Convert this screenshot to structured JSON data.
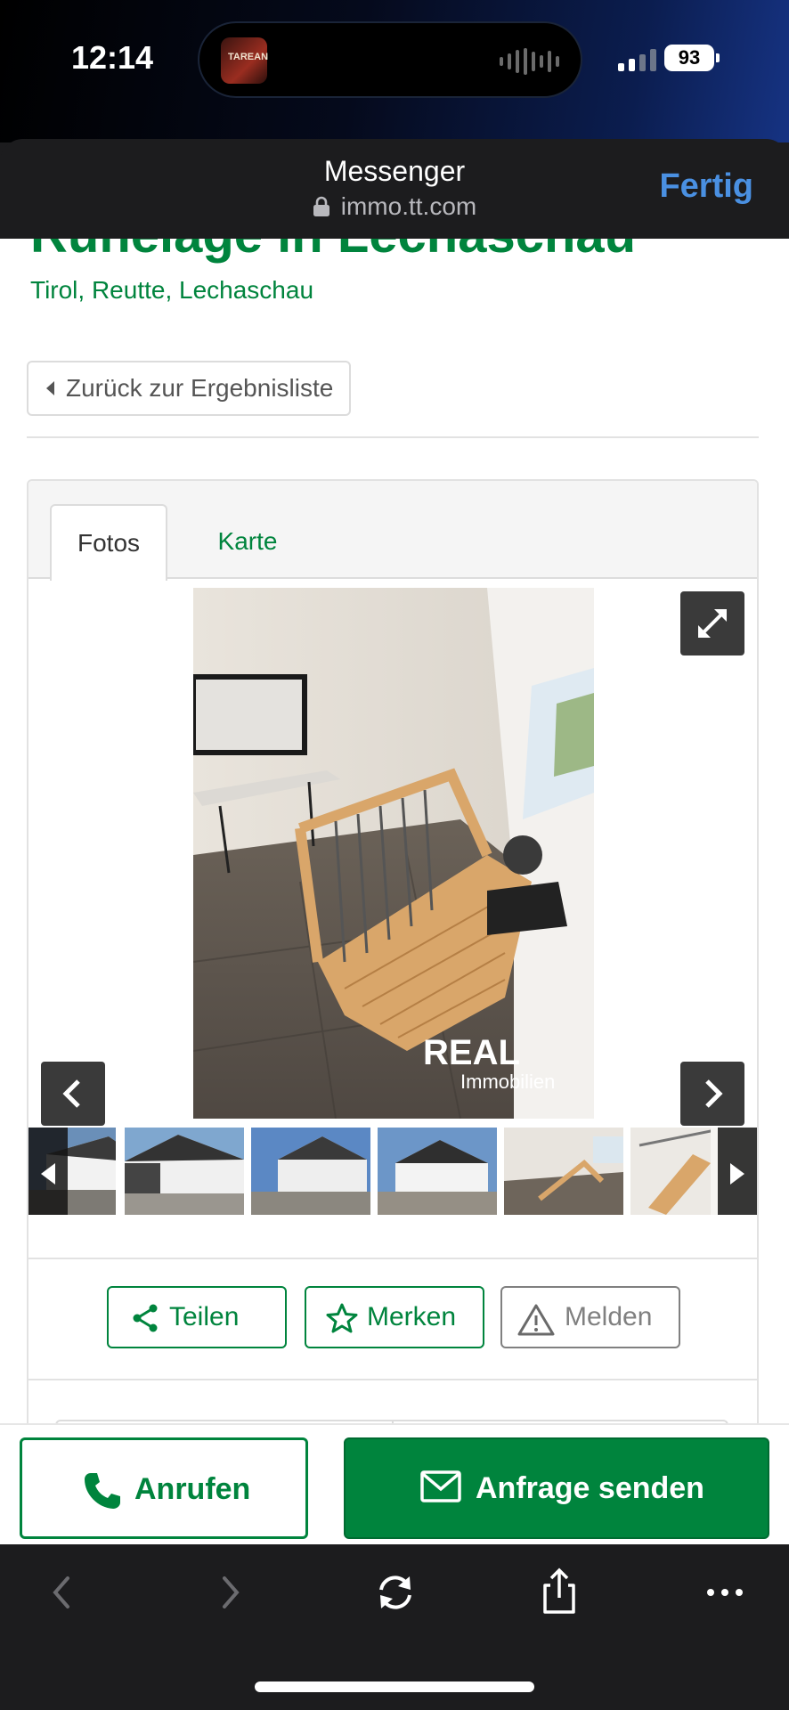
{
  "status_bar": {
    "time": "12:14",
    "battery": "93",
    "now_playing_art_text": "TAREAN",
    "colors": {
      "background_start": "#000000",
      "background_end": "#163383"
    }
  },
  "browser_sheet": {
    "title": "Messenger",
    "url": "immo.tt.com",
    "done_label": "Fertig",
    "icons": [
      "lock-icon"
    ],
    "colors": {
      "done": "#4a90e2",
      "background": "#1c1c1e"
    }
  },
  "listing": {
    "title": "Ruhelage in Lechaschau",
    "location": "Tirol, Reutte, Lechaschau",
    "back_label": "Zurück zur Ergebnisliste",
    "brand_color": "#00843d"
  },
  "gallery": {
    "tabs": [
      {
        "label": "Fotos",
        "active": true
      },
      {
        "label": "Karte",
        "active": false
      }
    ],
    "watermark": {
      "brand": "REAL",
      "sub": "Immobilien"
    },
    "thumbnail_count": 7,
    "icons": [
      "expand-icon",
      "chevron-left-icon",
      "chevron-right-icon"
    ]
  },
  "actions": {
    "share_label": "Teilen",
    "save_label": "Merken",
    "report_label": "Melden",
    "icons": [
      "share-icon",
      "star-icon",
      "warning-icon"
    ]
  },
  "contact_bar": {
    "call_label": "Anrufen",
    "send_label": "Anfrage senden",
    "icons": [
      "phone-icon",
      "mail-icon"
    ]
  },
  "toolbar": {
    "icons": [
      "back-arrow-icon",
      "forward-arrow-icon",
      "reload-icon",
      "share-icon",
      "more-icon"
    ]
  }
}
